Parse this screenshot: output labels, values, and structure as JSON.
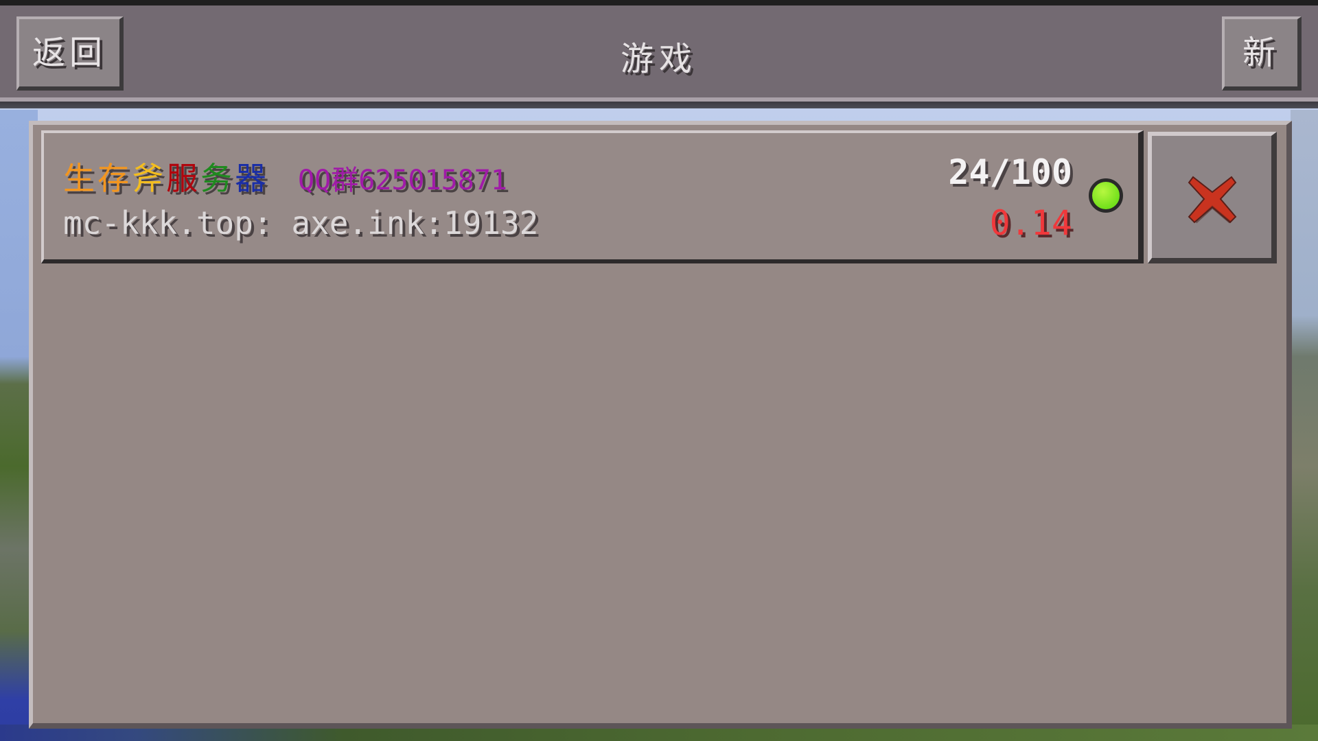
{
  "header": {
    "back_label": "返回",
    "title": "游戏",
    "new_label": "新"
  },
  "server": {
    "name_segments": [
      {
        "text": "生存",
        "color": "#f3961f"
      },
      {
        "text": "斧",
        "color": "#f3bd1f"
      },
      {
        "text": "服",
        "color": "#b0060e"
      },
      {
        "text": "务",
        "color": "#1f8a1f"
      },
      {
        "text": "器",
        "color": "#1a2ea6"
      },
      {
        "text": "QQ群625015871",
        "color": "#a01aa8"
      }
    ],
    "address": "mc-kkk.top: axe.ink:19132",
    "players": "24/100",
    "version": "0.14",
    "status": "online",
    "status_color": "#72e01b"
  },
  "icons": {
    "delete": "close-x-icon",
    "status": "status-dot-icon"
  },
  "colors": {
    "panel": "#958885",
    "topbar": "#736a72",
    "version_text": "#f0383b",
    "delete_x": "#c9331f"
  }
}
